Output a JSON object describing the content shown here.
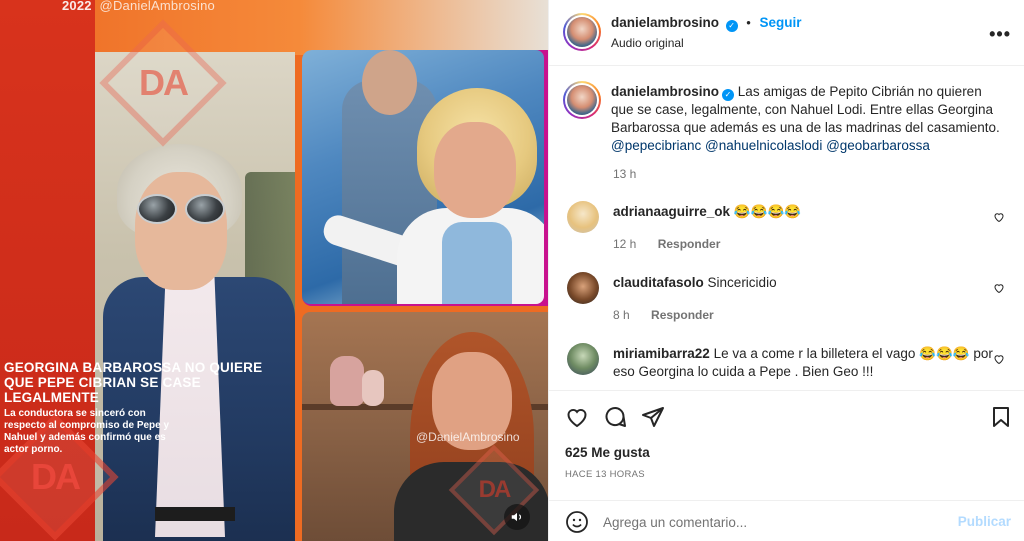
{
  "media": {
    "top_watermark_year": "2022",
    "top_watermark_handle": "@DanielAmbrosino",
    "inner_watermark": "@DanielAmbrosino",
    "logo_text": "DA",
    "headline": "GEORGINA BARBAROSSA NO QUIERE QUE PEPE CIBRIAN SE CASE LEGALMENTE",
    "subheadline": "La conductora se sinceró con respecto al compromiso de Pepe y Nahuel y además confirmó que es actor porno."
  },
  "header": {
    "username": "danielambrosino",
    "verified": true,
    "separator": "•",
    "follow_label": "Seguir",
    "subtitle": "Audio original",
    "more_label": "•••"
  },
  "caption": {
    "username": "danielambrosino",
    "text": "Las amigas de Pepito Cibrián no quieren que se case, legalmente, con Nahuel Lodi. Entre ellas Georgina Barbarossa que además es una de las madrinas del casamiento.",
    "mentions": [
      "@pepecibrianc",
      "@nahuelnicolaslodi",
      "@geobarbarossa"
    ],
    "time": "13 h"
  },
  "comments": [
    {
      "username": "adrianaaguirre_ok",
      "text": "😂😂😂😂",
      "time": "12 h",
      "reply_label": "Responder"
    },
    {
      "username": "clauditafasolo",
      "text": "Sincericidio",
      "time": "8 h",
      "reply_label": "Responder"
    },
    {
      "username": "miriamibarra22",
      "text": "Le va a come r la billetera el vago 😂😂😂 por eso Georgina lo cuida a Pepe . Bien Geo !!!",
      "time": "",
      "reply_label": ""
    }
  ],
  "actions": {
    "likes": "625 Me gusta",
    "posted_ago": "HACE 13 HORAS"
  },
  "add_comment": {
    "placeholder": "Agrega un comentario...",
    "publish_label": "Publicar"
  },
  "colors": {
    "brand_blue": "#0095f6",
    "mention": "#00376b",
    "muted": "#737373",
    "publish_disabled": "#b3dbff"
  },
  "icons": [
    "heart-icon",
    "comment-icon",
    "share-icon",
    "bookmark-icon",
    "emoji-icon",
    "volume-icon",
    "more-icon",
    "verified-icon"
  ]
}
